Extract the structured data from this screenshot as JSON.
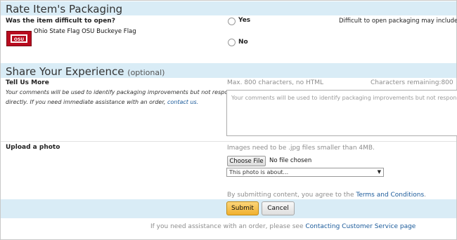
{
  "packaging": {
    "title": "Rate Item's Packaging",
    "question": "Was the item difficult to open?",
    "product_name": "Ohio State Flag OSU Buckeye Flag",
    "option_yes": "Yes",
    "option_no": "No",
    "hint": "Difficult to open packaging may include"
  },
  "experience": {
    "title": "Share Your Experience",
    "optional": "(optional)",
    "tell_us_label": "Tell Us More",
    "tell_us_desc_1": "Your comments will be used to identify packaging improvements but not responded to",
    "tell_us_desc_2": "directly. If you need immediate assistance with an order,",
    "contact_link": "contact us.",
    "max_chars": "Max. 800 characters, no HTML",
    "remaining": "Characters remaining:800",
    "textarea_placeholder": "Your comments will be used to identify packaging improvements but not responded to dir"
  },
  "photo": {
    "label": "Upload a photo",
    "requirement": "Images need to be .jpg files smaller than 4MB.",
    "choose_button": "Choose File",
    "no_file": "No file chosen",
    "select_value": "This photo is about..."
  },
  "terms": {
    "prefix": "By submitting content, you agree to the",
    "link": "Terms and Conditions",
    "suffix": "."
  },
  "actions": {
    "submit": "Submit",
    "cancel": "Cancel"
  },
  "footer": {
    "text": "If you need assistance with an order, please see",
    "link": "Contacting Customer Service page"
  },
  "colors": {
    "band": "#d9ecf6",
    "link": "#1a5a9a",
    "submit": "#f0b130"
  }
}
